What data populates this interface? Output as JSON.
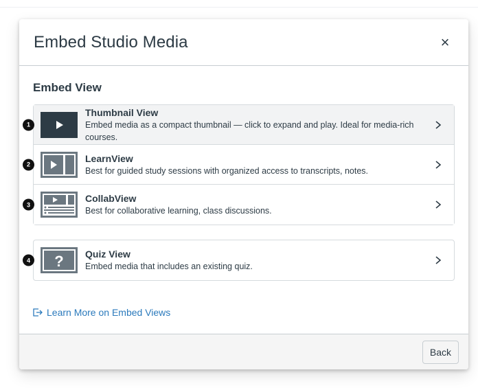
{
  "modal": {
    "title": "Embed Studio Media",
    "close_glyph": "×"
  },
  "section": {
    "title": "Embed View"
  },
  "options": [
    {
      "badge": "1",
      "title": "Thumbnail View",
      "description": "Embed media as a compact thumbnail — click to expand and play. Ideal for media-rich courses.",
      "icon": "thumbnail-view-icon",
      "selected": true
    },
    {
      "badge": "2",
      "title": "LearnView",
      "description": "Best for guided study sessions with organized access to transcripts, notes.",
      "icon": "learnview-icon",
      "selected": false
    },
    {
      "badge": "3",
      "title": "CollabView",
      "description": "Best for collaborative learning, class discussions.",
      "icon": "collabview-icon",
      "selected": false
    },
    {
      "badge": "4",
      "title": "Quiz View",
      "description": "Embed media that includes an existing quiz.",
      "icon": "quiz-view-icon",
      "selected": false
    }
  ],
  "learn_more": {
    "label": "Learn More on Embed Views",
    "icon": "external-link-icon"
  },
  "footer": {
    "back_label": "Back"
  },
  "colors": {
    "text": "#2d3b45",
    "link": "#2b7abc",
    "border": "#d5dadd",
    "selected_bg": "#f2f3f4",
    "footer_bg": "#f5f5f5"
  }
}
